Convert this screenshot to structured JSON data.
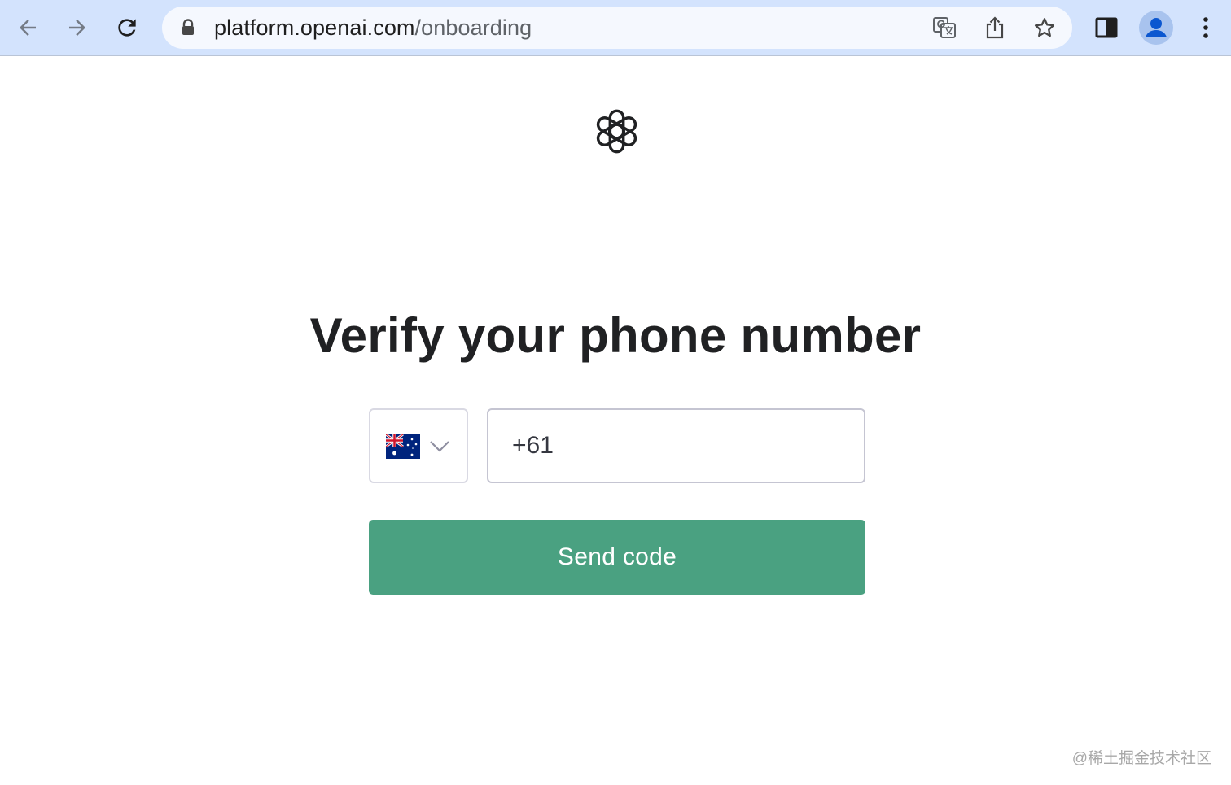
{
  "browser": {
    "url_host": "platform.openai.com",
    "url_path": "/onboarding",
    "icons": [
      "back-arrow-icon",
      "forward-arrow-icon",
      "reload-icon",
      "lock-icon",
      "translate-icon",
      "share-icon",
      "bookmark-star-icon",
      "side-panel-icon",
      "profile-avatar-icon",
      "more-menu-icon"
    ]
  },
  "page": {
    "logo": "openai-logo",
    "title": "Verify your phone number",
    "country": {
      "flag": "australia-flag-icon",
      "selected": "Australia"
    },
    "phone_value": "+61",
    "send_label": "Send code"
  },
  "colors": {
    "toolbar": "#d3e3fd",
    "button": "#4aa181",
    "title": "#202123"
  },
  "watermark": "@稀土掘金技术社区"
}
